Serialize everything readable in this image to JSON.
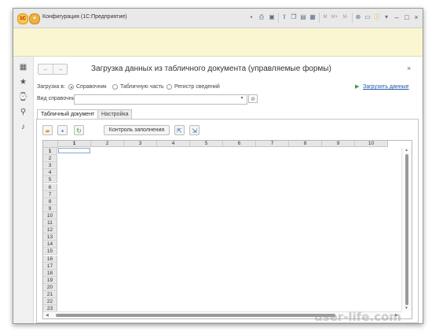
{
  "window": {
    "app_title": "Конфигурация  (1С:Предприятие)",
    "logo_text": "1С"
  },
  "form": {
    "title": "Загрузка данных из табличного документа (управляемые формы)",
    "load_to_label": "Загрузка в:",
    "radio_options": [
      {
        "label": "Справочник",
        "selected": true
      },
      {
        "label": "Табличную часть",
        "selected": false
      },
      {
        "label": "Регистр сведений",
        "selected": false
      }
    ],
    "load_link": "Загрузить данные",
    "catalog_kind_label": "Вид справочника:",
    "catalog_kind_value": ""
  },
  "tabs": [
    {
      "label": "Табличный документ",
      "active": true
    },
    {
      "label": "Настройка",
      "active": false
    }
  ],
  "toolbar": {
    "check_fill_label": "Контроль заполнения"
  },
  "sheet": {
    "columns": [
      "1",
      "2",
      "3",
      "4",
      "5",
      "6",
      "7",
      "8",
      "9",
      "10"
    ],
    "rows": [
      "1",
      "2",
      "3",
      "4",
      "5",
      "6",
      "7",
      "8",
      "9",
      "10",
      "11",
      "12",
      "13",
      "14",
      "15",
      "16",
      "17",
      "18",
      "19",
      "20",
      "21",
      "22",
      "23"
    ]
  },
  "watermark": "user-life.com",
  "colors": {
    "info_bar": "#faf6d2",
    "link": "#1b5aa8",
    "load_arrow": "#3c9a3c"
  }
}
